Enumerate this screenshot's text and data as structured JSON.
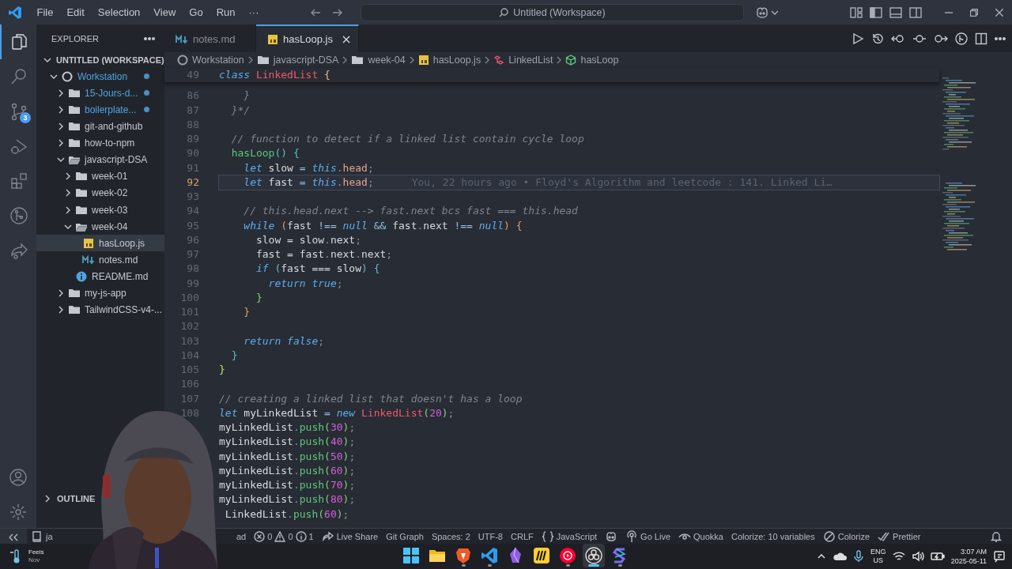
{
  "title_bar": {
    "menu": [
      "File",
      "Edit",
      "Selection",
      "View",
      "Go",
      "Run",
      "···"
    ],
    "command_center": "Untitled (Workspace)"
  },
  "activity_bar": {
    "items": [
      {
        "kind": "files",
        "selected": true
      },
      {
        "kind": "search",
        "selected": false
      },
      {
        "kind": "source-control",
        "selected": false,
        "badge": "3"
      },
      {
        "kind": "run-debug",
        "selected": false
      },
      {
        "kind": "extensions",
        "selected": false
      },
      {
        "kind": "git-graph",
        "selected": false
      },
      {
        "kind": "live-share",
        "selected": false
      }
    ]
  },
  "sidebar": {
    "title": "EXPLORER",
    "workspace": {
      "label": "UNTITLED (WORKSPACE)",
      "expanded": true
    },
    "tree": [
      {
        "label": "Workstation",
        "kind": "root",
        "expanded": true,
        "modified": true,
        "selected": false,
        "children": [
          {
            "label": "15-Jours-d...",
            "kind": "folder",
            "expanded": false,
            "modified": true,
            "selected": false
          },
          {
            "label": "boilerplate...",
            "kind": "folder",
            "expanded": false,
            "modified": true,
            "selected": false
          },
          {
            "label": "git-and-github",
            "kind": "folder",
            "expanded": false,
            "modified": false,
            "selected": false
          },
          {
            "label": "how-to-npm",
            "kind": "folder",
            "expanded": false,
            "modified": false,
            "selected": false
          },
          {
            "label": "javascript-DSA",
            "kind": "folder",
            "expanded": true,
            "modified": false,
            "selected": false,
            "children": [
              {
                "label": "week-01",
                "kind": "folder",
                "expanded": false,
                "modified": false,
                "selected": false
              },
              {
                "label": "week-02",
                "kind": "folder",
                "expanded": false,
                "modified": false,
                "selected": false
              },
              {
                "label": "week-03",
                "kind": "folder",
                "expanded": false,
                "modified": false,
                "selected": false
              },
              {
                "label": "week-04",
                "kind": "folder",
                "expanded": true,
                "modified": false,
                "selected": false,
                "children": [
                  {
                    "label": "hasLoop.js",
                    "kind": "js",
                    "modified": false,
                    "selected": true
                  },
                  {
                    "label": "notes.md",
                    "kind": "md",
                    "modified": false,
                    "selected": false
                  }
                ]
              },
              {
                "label": "README.md",
                "kind": "info",
                "modified": false,
                "selected": false
              }
            ]
          },
          {
            "label": "my-js-app",
            "kind": "folder",
            "expanded": false,
            "modified": false,
            "selected": false
          },
          {
            "label": "TailwindCSS-v4-...",
            "kind": "folder",
            "expanded": false,
            "modified": false,
            "selected": false
          }
        ]
      }
    ],
    "sections": [
      {
        "label": "OUTLINE",
        "expanded": false
      }
    ]
  },
  "editor": {
    "tabs": [
      {
        "label": "notes.md",
        "kind": "md",
        "selected": false
      },
      {
        "label": "hasLoop.js",
        "kind": "js",
        "selected": true
      }
    ],
    "breadcrumbs": [
      {
        "label": "Workstation",
        "kind": "root"
      },
      {
        "label": "javascript-DSA",
        "kind": "folder"
      },
      {
        "label": "week-04",
        "kind": "folder"
      },
      {
        "label": "hasLoop.js",
        "kind": "js"
      },
      {
        "label": "LinkedList",
        "kind": "class"
      },
      {
        "label": "hasLoop",
        "kind": "method"
      }
    ],
    "sticky_line": {
      "number": "49",
      "tokens": [
        {
          "text": "class",
          "kind": "kw"
        },
        {
          "text": " LinkedList",
          "kind": "cls"
        },
        {
          "text": " {",
          "kind": "br1"
        }
      ]
    },
    "lines": [
      {
        "number": "86",
        "current": false,
        "tokens": [
          {
            "text": "    }",
            "kind": "cmt"
          }
        ]
      },
      {
        "number": "87",
        "current": false,
        "tokens": [
          {
            "text": "  }*/",
            "kind": "cmt"
          }
        ]
      },
      {
        "number": "88",
        "current": false
      },
      {
        "number": "89",
        "current": false,
        "tokens": [
          {
            "text": "  // function to detect if a linked list contain cycle loop",
            "kind": "cmt"
          }
        ]
      },
      {
        "number": "90",
        "current": false,
        "tokens": [
          {
            "text": "  hasLoop",
            "kind": "fn"
          },
          {
            "text": "()",
            "kind": "br2"
          },
          {
            "text": " {",
            "kind": "br2"
          }
        ]
      },
      {
        "number": "91",
        "current": false,
        "tokens": [
          {
            "text": "    let",
            "kind": "kw"
          },
          {
            "text": " slow ",
            "kind": "plain"
          },
          {
            "text": "=",
            "kind": "op"
          },
          {
            "text": " this",
            "kind": "kw"
          },
          {
            "text": ".",
            "kind": "punct"
          },
          {
            "text": "head",
            "kind": "prop"
          },
          {
            "text": ";",
            "kind": "punct"
          }
        ]
      },
      {
        "number": "92",
        "current": true,
        "blame": "You, 22 hours ago • Floyd's Algorithm and leetcode : 141. Linked Li…",
        "tokens": [
          {
            "text": "    let",
            "kind": "kw"
          },
          {
            "text": " fast ",
            "kind": "plain"
          },
          {
            "text": "=",
            "kind": "op"
          },
          {
            "text": " this",
            "kind": "kw"
          },
          {
            "text": ".",
            "kind": "punct"
          },
          {
            "text": "head",
            "kind": "prop"
          },
          {
            "text": ";",
            "kind": "punct"
          }
        ]
      },
      {
        "number": "93",
        "current": false
      },
      {
        "number": "94",
        "current": false,
        "tokens": [
          {
            "text": "    // this.head.next --> fast.next bcs fast === this.head",
            "kind": "cmt"
          }
        ]
      },
      {
        "number": "95",
        "current": false,
        "tokens": [
          {
            "text": "    while",
            "kind": "kw"
          },
          {
            "text": " (",
            "kind": "br3"
          },
          {
            "text": "fast ",
            "kind": "plain"
          },
          {
            "text": "!==",
            "kind": "op"
          },
          {
            "text": " null",
            "kind": "kw"
          },
          {
            "text": " &&",
            "kind": "op"
          },
          {
            "text": " fast",
            "kind": "plain"
          },
          {
            "text": ".",
            "kind": "punct"
          },
          {
            "text": "next",
            "kind": "plain"
          },
          {
            "text": " !==",
            "kind": "op"
          },
          {
            "text": " null",
            "kind": "kw"
          },
          {
            "text": ")",
            "kind": "br3"
          },
          {
            "text": " {",
            "kind": "br3"
          }
        ]
      },
      {
        "number": "96",
        "current": false,
        "tokens": [
          {
            "text": "      slow = slow",
            "kind": "plain"
          },
          {
            "text": ".",
            "kind": "punct"
          },
          {
            "text": "next",
            "kind": "plain"
          },
          {
            "text": ";",
            "kind": "punct"
          }
        ]
      },
      {
        "number": "97",
        "current": false,
        "tokens": [
          {
            "text": "      fast = fast",
            "kind": "plain"
          },
          {
            "text": ".",
            "kind": "punct"
          },
          {
            "text": "next",
            "kind": "plain"
          },
          {
            "text": ".",
            "kind": "punct"
          },
          {
            "text": "next",
            "kind": "plain"
          },
          {
            "text": ";",
            "kind": "punct"
          }
        ]
      },
      {
        "number": "98",
        "current": false,
        "tokens": [
          {
            "text": "      if",
            "kind": "kw"
          },
          {
            "text": " (",
            "kind": "br2"
          },
          {
            "text": "fast === slow",
            "kind": "plain"
          },
          {
            "text": ")",
            "kind": "br2"
          },
          {
            "text": " {",
            "kind": "br2"
          }
        ]
      },
      {
        "number": "99",
        "current": false,
        "tokens": [
          {
            "text": "        return",
            "kind": "kw"
          },
          {
            "text": " true",
            "kind": "kw"
          },
          {
            "text": ";",
            "kind": "punct"
          }
        ]
      },
      {
        "number": "100",
        "current": false,
        "tokens": [
          {
            "text": "      }",
            "kind": "br4"
          }
        ]
      },
      {
        "number": "101",
        "current": false,
        "tokens": [
          {
            "text": "    }",
            "kind": "br3"
          }
        ]
      },
      {
        "number": "102",
        "current": false
      },
      {
        "number": "103",
        "current": false,
        "tokens": [
          {
            "text": "    return",
            "kind": "kw"
          },
          {
            "text": " false",
            "kind": "kw"
          },
          {
            "text": ";",
            "kind": "punct"
          }
        ]
      },
      {
        "number": "104",
        "current": false,
        "tokens": [
          {
            "text": "  }",
            "kind": "br2"
          }
        ]
      },
      {
        "number": "105",
        "current": false,
        "tokens": [
          {
            "text": "}",
            "kind": "br5"
          }
        ]
      },
      {
        "number": "106",
        "current": false
      },
      {
        "number": "107",
        "current": false,
        "tokens": [
          {
            "text": "// creating a linked list that doesn't has a loop",
            "kind": "cmt"
          }
        ]
      },
      {
        "number": "108",
        "current": false,
        "tokens": [
          {
            "text": "let",
            "kind": "kw"
          },
          {
            "text": " myLinkedList ",
            "kind": "plain"
          },
          {
            "text": "=",
            "kind": "op"
          },
          {
            "text": " new",
            "kind": "kw"
          },
          {
            "text": " LinkedList",
            "kind": "cls"
          },
          {
            "text": "(",
            "kind": "br4"
          },
          {
            "text": "20",
            "kind": "num"
          },
          {
            "text": ")",
            "kind": "br4"
          },
          {
            "text": ";",
            "kind": "punct"
          }
        ]
      },
      {
        "current": false,
        "tokens": [
          {
            "text": "myLinkedList",
            "kind": "plain"
          },
          {
            "text": ".",
            "kind": "punct"
          },
          {
            "text": "push",
            "kind": "fn"
          },
          {
            "text": "(",
            "kind": "br4"
          },
          {
            "text": "30",
            "kind": "num"
          },
          {
            "text": ")",
            "kind": "br4"
          },
          {
            "text": ";",
            "kind": "punct"
          }
        ]
      },
      {
        "current": false,
        "tokens": [
          {
            "text": "myLinkedList",
            "kind": "plain"
          },
          {
            "text": ".",
            "kind": "punct"
          },
          {
            "text": "push",
            "kind": "fn"
          },
          {
            "text": "(",
            "kind": "br4"
          },
          {
            "text": "40",
            "kind": "num"
          },
          {
            "text": ")",
            "kind": "br4"
          },
          {
            "text": ";",
            "kind": "punct"
          }
        ]
      },
      {
        "current": false,
        "tokens": [
          {
            "text": "myLinkedList",
            "kind": "plain"
          },
          {
            "text": ".",
            "kind": "punct"
          },
          {
            "text": "push",
            "kind": "fn"
          },
          {
            "text": "(",
            "kind": "br4"
          },
          {
            "text": "50",
            "kind": "num"
          },
          {
            "text": ")",
            "kind": "br4"
          },
          {
            "text": ";",
            "kind": "punct"
          }
        ]
      },
      {
        "current": false,
        "tokens": [
          {
            "text": "myLinkedList",
            "kind": "plain"
          },
          {
            "text": ".",
            "kind": "punct"
          },
          {
            "text": "push",
            "kind": "fn"
          },
          {
            "text": "(",
            "kind": "br4"
          },
          {
            "text": "60",
            "kind": "num"
          },
          {
            "text": ")",
            "kind": "br4"
          },
          {
            "text": ";",
            "kind": "punct"
          }
        ]
      },
      {
        "current": false,
        "tokens": [
          {
            "text": "myLinkedList",
            "kind": "plain"
          },
          {
            "text": ".",
            "kind": "punct"
          },
          {
            "text": "push",
            "kind": "fn"
          },
          {
            "text": "(",
            "kind": "br4"
          },
          {
            "text": "70",
            "kind": "num"
          },
          {
            "text": ")",
            "kind": "br4"
          },
          {
            "text": ";",
            "kind": "punct"
          }
        ]
      },
      {
        "current": false,
        "tokens": [
          {
            "text": "myLinkedList",
            "kind": "plain"
          },
          {
            "text": ".",
            "kind": "punct"
          },
          {
            "text": "push",
            "kind": "fn"
          },
          {
            "text": "(",
            "kind": "br4"
          },
          {
            "text": "80",
            "kind": "num"
          },
          {
            "text": ")",
            "kind": "br4"
          },
          {
            "text": ";",
            "kind": "punct"
          }
        ]
      },
      {
        "current": false,
        "tokens": [
          {
            "text": " LinkedList",
            "kind": "plain"
          },
          {
            "text": ".",
            "kind": "punct"
          },
          {
            "text": "push",
            "kind": "fn"
          },
          {
            "text": "(",
            "kind": "br4"
          },
          {
            "text": "60",
            "kind": "num"
          },
          {
            "text": ")",
            "kind": "br4"
          },
          {
            "text": ";",
            "kind": "punct"
          }
        ]
      }
    ]
  },
  "status_bar": {
    "left": [
      {
        "kind": "remote"
      },
      {
        "kind": "book",
        "text": "ja"
      }
    ],
    "items": [
      {
        "kind": "plain",
        "text": "ad"
      },
      {
        "kind": "problems",
        "errors": "0",
        "warnings": "0",
        "infos": "1"
      },
      {
        "kind": "live-share",
        "text": "Live Share"
      },
      {
        "kind": "plain",
        "text": "Git Graph"
      },
      {
        "kind": "plain",
        "text": "Spaces: 2"
      },
      {
        "kind": "plain",
        "text": "UTF-8"
      },
      {
        "kind": "plain",
        "text": "CRLF"
      },
      {
        "kind": "braces",
        "text": "JavaScript"
      },
      {
        "kind": "copilot"
      },
      {
        "kind": "broadcast",
        "text": "Go Live"
      },
      {
        "kind": "eye",
        "text": "Quokka"
      },
      {
        "kind": "plain",
        "text": "Colorize: 10 variables"
      },
      {
        "kind": "ban",
        "text": "Colorize"
      },
      {
        "kind": "check",
        "text": "Prettier"
      },
      {
        "kind": "bell"
      }
    ]
  },
  "taskbar": {
    "weather": {
      "line1": "Feels",
      "line2": "Nov"
    },
    "apps": [
      {
        "kind": "start",
        "running": false,
        "selected": false
      },
      {
        "kind": "folder",
        "running": false,
        "selected": false
      },
      {
        "kind": "shield",
        "running": true,
        "selected": false
      },
      {
        "kind": "ribbon",
        "running": true,
        "selected": false
      },
      {
        "kind": "crystal",
        "running": false,
        "selected": false
      },
      {
        "kind": "stripes-tile",
        "running": false,
        "selected": false
      },
      {
        "kind": "play-circle",
        "running": true,
        "selected": false
      },
      {
        "kind": "aperture",
        "running": true,
        "selected": true
      },
      {
        "kind": "s-shape",
        "running": true,
        "selected": false
      }
    ],
    "language": {
      "line1": "ENG",
      "line2": "US"
    },
    "clock": {
      "time": "3:07 AM",
      "date": "2025-05-11"
    }
  }
}
